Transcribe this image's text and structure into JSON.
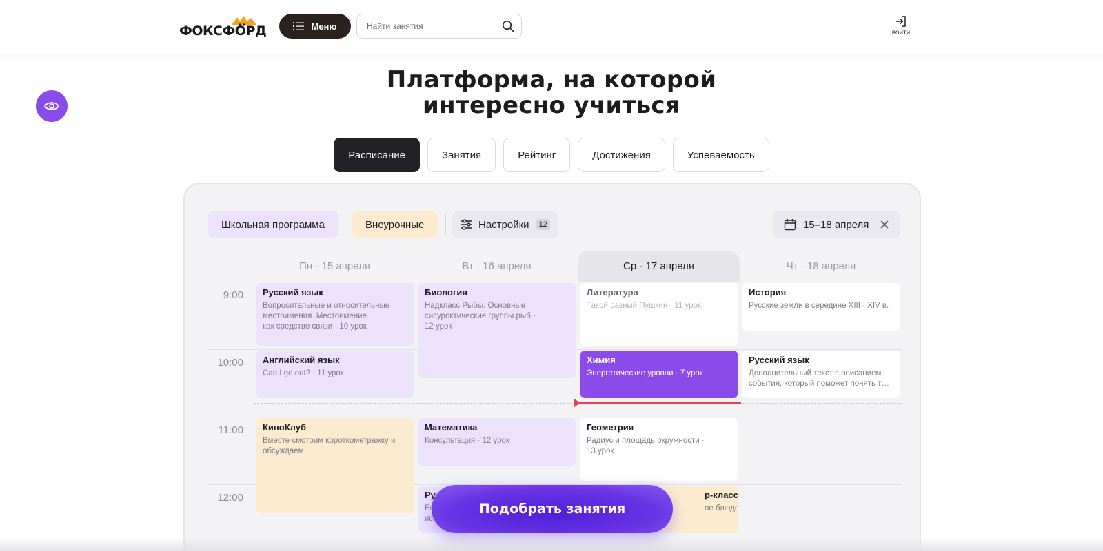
{
  "header": {
    "logo_text": "ФОКСФОРД",
    "menu_label": "Меню",
    "search_placeholder": "Найти занятия",
    "login_label": "войти"
  },
  "hero": {
    "title_line1": "Платформа, на которой",
    "title_line2": "интересно учиться"
  },
  "tabs": [
    {
      "label": "Расписание",
      "active": true
    },
    {
      "label": "Занятия",
      "active": false
    },
    {
      "label": "Рейтинг",
      "active": false
    },
    {
      "label": "Достижения",
      "active": false
    },
    {
      "label": "Успеваемость",
      "active": false
    }
  ],
  "filters": {
    "school": "Школьная программа",
    "extra": "Внеурочные",
    "settings": "Настройки",
    "settings_count": "12",
    "date_range": "15–18 апреля"
  },
  "schedule": {
    "days": [
      "Пн · 15 апреля",
      "Вт · 16 апреля",
      "Ср · 17 апреля",
      "Чт · 18 апреля"
    ],
    "today_index": 2,
    "times": [
      "9:00",
      "10:00",
      "11:00",
      "12:00"
    ],
    "lessons": {
      "mon_1": {
        "title": "Русский язык",
        "desc_line1": "Вопросительные и относительные",
        "desc_line2": "местоимения. Местоимение",
        "desc_line3": "как средство связи · 10 урок"
      },
      "mon_2": {
        "title": "Английский язык",
        "desc": "Can I go out? · 11 урок"
      },
      "mon_3": {
        "title": "КиноКлуб",
        "desc_line1": "Вместе смотрим короткометражку и",
        "desc_line2": "обсуждаем"
      },
      "tue_1": {
        "title": "Биология",
        "desc_line1": "Надкласс Рыбы. Основные",
        "desc_line2": "сисуроктические группы рыб ·",
        "desc_line3": "12 урок"
      },
      "tue_2": {
        "title": "Математика",
        "desc": "Консультация · 12 урок"
      },
      "tue_3": {
        "title": "Ру",
        "desc_line1": "Ев",
        "desc_line2": "ис"
      },
      "wed_1": {
        "title": "Литература",
        "desc": "Такой разный Пушкин · 11 урок"
      },
      "wed_2": {
        "title": "Химия",
        "desc": "Энергетические уровни · 7 урок"
      },
      "wed_3": {
        "title": "Геометрия",
        "desc_line1": "Радиус и площадь окружности ·",
        "desc_line2": "13 урок"
      },
      "wed_4": {
        "title": "р-класс",
        "desc": "ое блюдо"
      },
      "thu_1": {
        "title": "История",
        "desc": "Русские земли в середине XIII - XIV в."
      },
      "thu_2": {
        "title": "Русский язык",
        "desc_line1": "Дополнительный текст с описанием",
        "desc_line2": "события, который поможет понять т…"
      }
    }
  },
  "cta_label": "Подобрать занятия",
  "colors": {
    "accent": "#8b4bea",
    "dark": "#222226",
    "menu": "#2b211e",
    "lesson_school": "#ece2fb",
    "lesson_extra": "#fdebcf",
    "now_line": "#e8434c"
  },
  "icons": [
    "list-icon",
    "search-icon",
    "login-icon",
    "eye-icon",
    "sliders-icon",
    "calendar-icon",
    "close-icon"
  ]
}
